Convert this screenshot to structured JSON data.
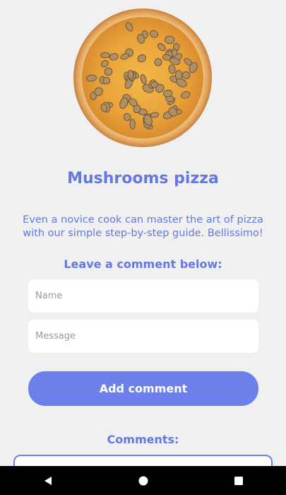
{
  "recipe": {
    "title": "Mushrooms pizza",
    "description": "Even a novice cook can master the art of pizza with our simple step-by-step guide. Bellissimo!",
    "image_icon": "pizza-image"
  },
  "comment_form": {
    "heading": "Leave a comment below:",
    "name_placeholder": "Name",
    "message_placeholder": "Message",
    "submit_label": "Add comment"
  },
  "comments": {
    "heading": "Comments:"
  },
  "system_nav": {
    "back_icon": "back-triangle-icon",
    "home_icon": "home-circle-icon",
    "recents_icon": "recents-square-icon"
  },
  "colors": {
    "accent": "#6478e0",
    "button": "#6b80ea",
    "background": "#f0f0f0",
    "navbar": "#000000"
  }
}
